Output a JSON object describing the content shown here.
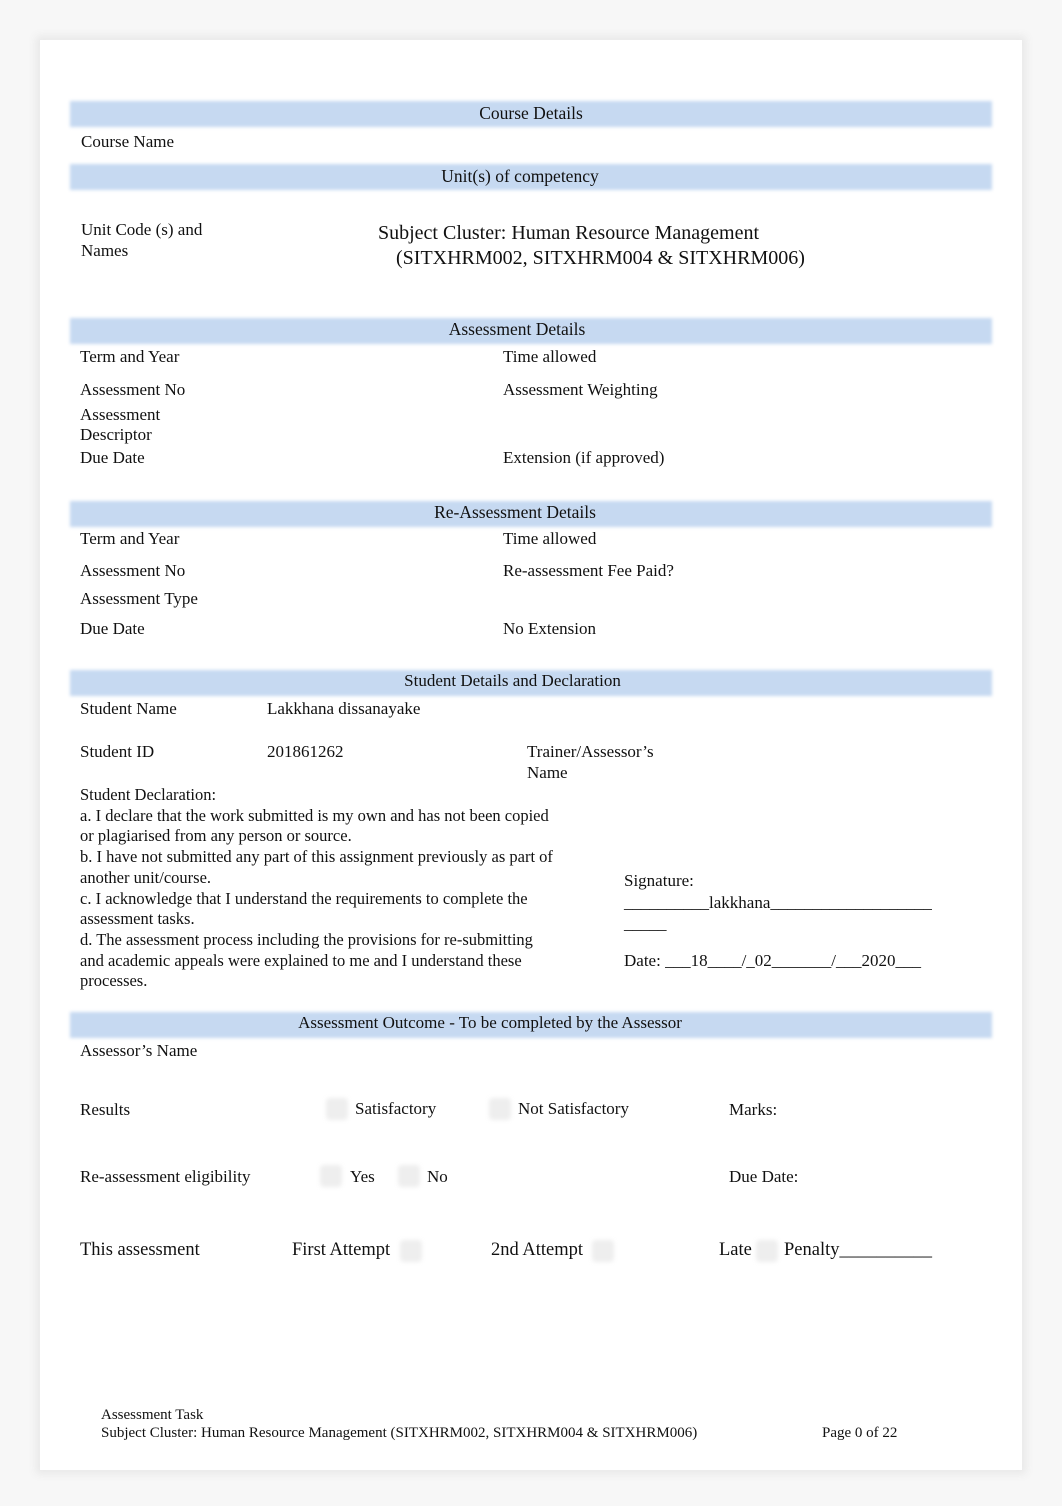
{
  "course_details": {
    "header": "Course Details",
    "course_name_label": "Course Name"
  },
  "units": {
    "header": "Unit(s) of competency",
    "label": "Unit Code (s) and Names",
    "line1": "Subject Cluster: Human Resource Management",
    "line2": "(SITXHRM002, SITXHRM004 & SITXHRM006)"
  },
  "assessment": {
    "header": "Assessment Details",
    "term": "Term and Year",
    "time": "Time allowed",
    "no": "Assessment No",
    "weighting": "Assessment Weighting",
    "descriptor": "Assessment Descriptor",
    "due": "Due Date",
    "extension": "Extension (if approved)"
  },
  "reassessment": {
    "header": "Re-Assessment Details",
    "term": "Term and Year",
    "time": "Time allowed",
    "no": "Assessment No",
    "fee": "Re-assessment Fee Paid?",
    "type": "Assessment Type",
    "due": "Due Date",
    "no_ext": "No Extension"
  },
  "student": {
    "header": "Student Details and Declaration",
    "name_label": "Student Name",
    "name": "Lakkhana dissanayake",
    "id_label": "Student ID",
    "id": "201861262",
    "trainer_label": "Trainer/Assessor’s Name",
    "declaration": "Student Declaration:\na. I declare that the work submitted is my own and has not been copied or plagiarised from any person or source.\nb. I have not submitted any part of this assignment previously as part of another unit/course.\nc. I acknowledge that I understand the requirements to complete the assessment tasks.\nd. The assessment process including the provisions for re-submitting and academic appeals were explained to me and I understand these processes.",
    "signature_label": "Signature:",
    "signature": "__________lakkhana___________________",
    "signature_cont": "_____",
    "date": "Date: ___18____/_02_______/___2020___"
  },
  "outcome": {
    "header": "Assessment Outcome - To be completed by the Assessor",
    "assessor": "Assessor’s Name",
    "results": "Results",
    "satisfactory": "Satisfactory",
    "not_satisfactory": "Not Satisfactory",
    "marks": "Marks:",
    "eligibility": "Re-assessment eligibility",
    "yes": "Yes",
    "no": "No",
    "due": "Due Date:",
    "this": "This assessment",
    "first": "First Attempt",
    "second": "2nd Attempt",
    "late": "Late",
    "penalty": "Penalty__________"
  },
  "footer": {
    "line1": "Assessment Task",
    "line2": "Subject Cluster: Human Resource Management (SITXHRM002, SITXHRM004 & SITXHRM006)",
    "page": "Page 0 of 22"
  }
}
